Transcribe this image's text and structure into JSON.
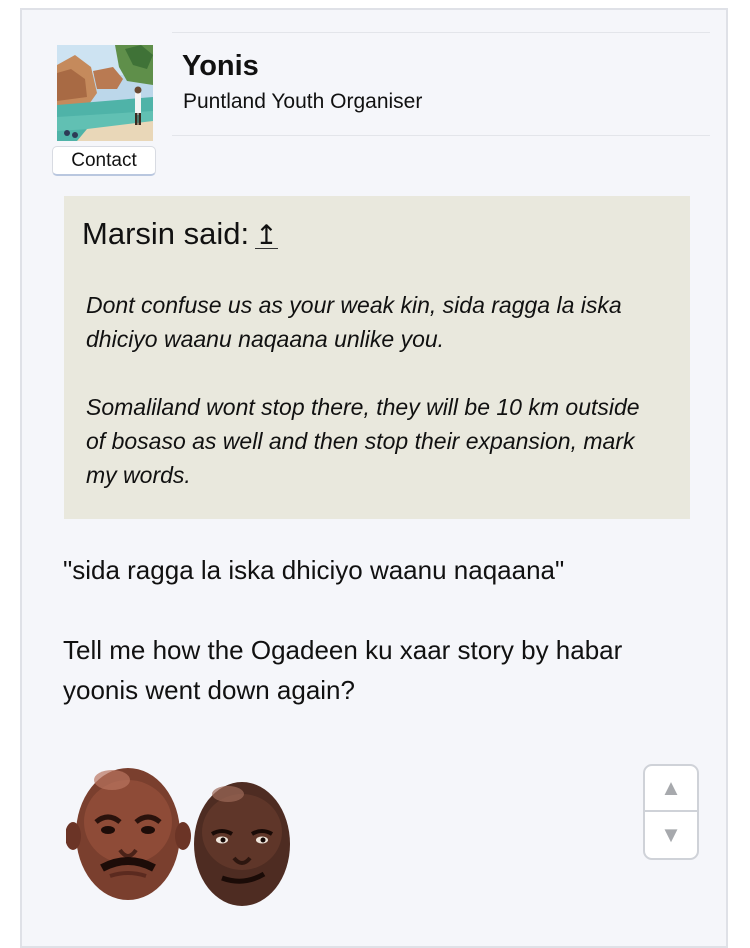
{
  "post": {
    "author": {
      "name": "Yonis",
      "title": "Puntland Youth Organiser",
      "avatar_icon": "landscape-avatar-icon",
      "contact_label": "Contact"
    },
    "quote": {
      "header": "Marsin said:",
      "jump_icon": "↥",
      "paragraphs": [
        "Dont confuse us as your weak kin, sida ragga la iska dhiciyo waanu naqaana unlike you.",
        "Somaliland wont stop there, they will be 10 km outside of bosaso as well and then stop their expansion, mark my words."
      ]
    },
    "body": [
      "\"sida ragga la iska dhiciyo waanu naqaana\"",
      "Tell me how the Ogadeen ku xaar story by habar yoonis went down again?"
    ],
    "emoji_icons": [
      "crying-jordan-face-icon",
      "smirking-jordan-face-icon"
    ]
  },
  "scroll_controls": {
    "up_icon": "▲",
    "down_icon": "▼"
  }
}
